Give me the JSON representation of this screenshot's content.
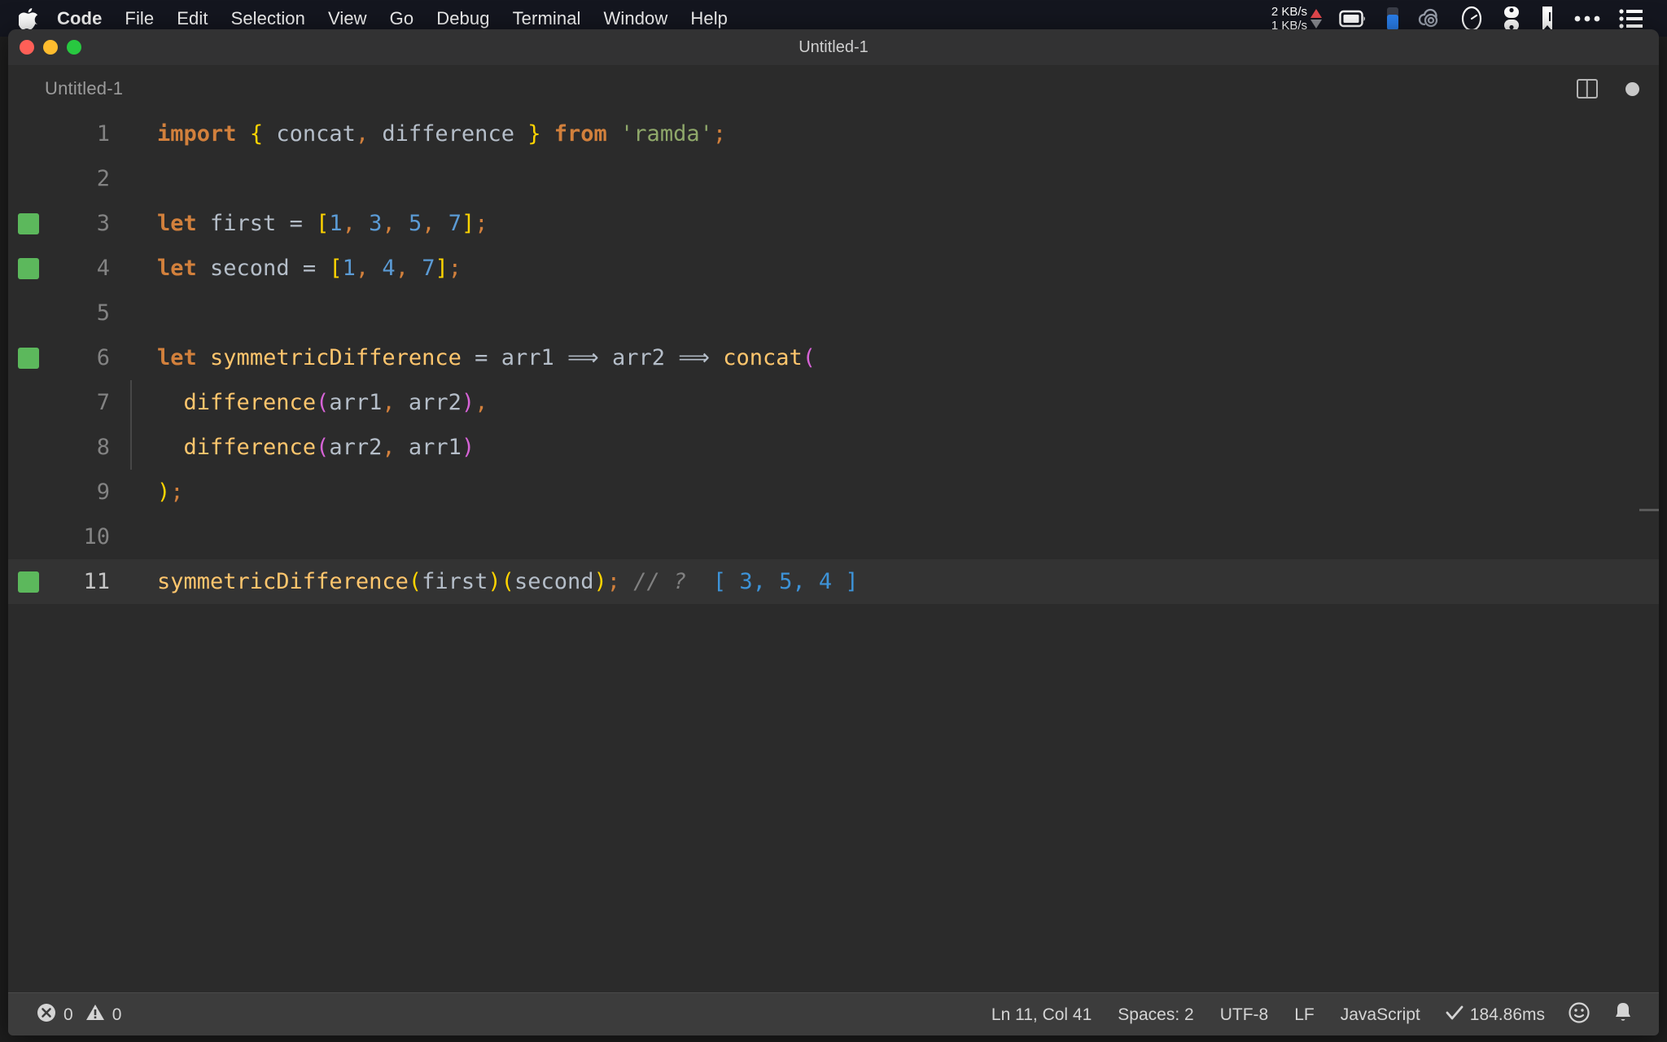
{
  "menubar": {
    "apple_icon": "apple-logo-icon",
    "items": [
      {
        "label": "Code",
        "bold": true
      },
      {
        "label": "File",
        "bold": false
      },
      {
        "label": "Edit",
        "bold": false
      },
      {
        "label": "Selection",
        "bold": false
      },
      {
        "label": "View",
        "bold": false
      },
      {
        "label": "Go",
        "bold": false
      },
      {
        "label": "Debug",
        "bold": false
      },
      {
        "label": "Terminal",
        "bold": false
      },
      {
        "label": "Window",
        "bold": false
      },
      {
        "label": "Help",
        "bold": false
      }
    ],
    "network": {
      "upload": "2 KB/s",
      "download": "1 KB/s",
      "up_arrow_color": "#e5484d",
      "down_arrow_color": "#8b8d93"
    },
    "status_icons": [
      "battery-icon",
      "battery-gauge-icon",
      "cloud-sync-icon",
      "timer-icon",
      "toggles-icon",
      "bookmark-icon",
      "ellipsis-icon",
      "list-menu-icon"
    ]
  },
  "window": {
    "title": "Untitled-1",
    "traffic_lights": [
      "close-button",
      "minimize-button",
      "maximize-button"
    ]
  },
  "tabstrip": {
    "tab_label": "Untitled-1",
    "split_editor_label": "split-editor-icon",
    "unsaved_indicator_label": "unsaved-dot-icon"
  },
  "editor": {
    "language": "JavaScript",
    "active_line": 11,
    "lines": [
      {
        "number": "1",
        "marked": false,
        "active": false,
        "tokens": [
          {
            "text": "import",
            "cls": "t-keyword"
          },
          {
            "text": " ",
            "cls": "t-plain"
          },
          {
            "text": "{",
            "cls": "t-brace"
          },
          {
            "text": " concat",
            "cls": "t-plain"
          },
          {
            "text": ",",
            "cls": "t-punct"
          },
          {
            "text": " difference ",
            "cls": "t-plain"
          },
          {
            "text": "}",
            "cls": "t-brace"
          },
          {
            "text": " ",
            "cls": "t-plain"
          },
          {
            "text": "from",
            "cls": "t-keyword"
          },
          {
            "text": " ",
            "cls": "t-plain"
          },
          {
            "text": "'ramda'",
            "cls": "t-string"
          },
          {
            "text": ";",
            "cls": "t-punct"
          }
        ]
      },
      {
        "number": "2",
        "marked": false,
        "active": false,
        "tokens": []
      },
      {
        "number": "3",
        "marked": true,
        "active": false,
        "tokens": [
          {
            "text": "let",
            "cls": "t-keyword"
          },
          {
            "text": " first ",
            "cls": "t-plain"
          },
          {
            "text": "=",
            "cls": "t-plain"
          },
          {
            "text": " ",
            "cls": "t-plain"
          },
          {
            "text": "[",
            "cls": "t-brace"
          },
          {
            "text": "1",
            "cls": "t-number"
          },
          {
            "text": ",",
            "cls": "t-punct"
          },
          {
            "text": " ",
            "cls": "t-plain"
          },
          {
            "text": "3",
            "cls": "t-number"
          },
          {
            "text": ",",
            "cls": "t-punct"
          },
          {
            "text": " ",
            "cls": "t-plain"
          },
          {
            "text": "5",
            "cls": "t-number"
          },
          {
            "text": ",",
            "cls": "t-punct"
          },
          {
            "text": " ",
            "cls": "t-plain"
          },
          {
            "text": "7",
            "cls": "t-number"
          },
          {
            "text": "]",
            "cls": "t-brace"
          },
          {
            "text": ";",
            "cls": "t-punct"
          }
        ]
      },
      {
        "number": "4",
        "marked": true,
        "active": false,
        "tokens": [
          {
            "text": "let",
            "cls": "t-keyword"
          },
          {
            "text": " second ",
            "cls": "t-plain"
          },
          {
            "text": "=",
            "cls": "t-plain"
          },
          {
            "text": " ",
            "cls": "t-plain"
          },
          {
            "text": "[",
            "cls": "t-brace"
          },
          {
            "text": "1",
            "cls": "t-number"
          },
          {
            "text": ",",
            "cls": "t-punct"
          },
          {
            "text": " ",
            "cls": "t-plain"
          },
          {
            "text": "4",
            "cls": "t-number"
          },
          {
            "text": ",",
            "cls": "t-punct"
          },
          {
            "text": " ",
            "cls": "t-plain"
          },
          {
            "text": "7",
            "cls": "t-number"
          },
          {
            "text": "]",
            "cls": "t-brace"
          },
          {
            "text": ";",
            "cls": "t-punct"
          }
        ]
      },
      {
        "number": "5",
        "marked": false,
        "active": false,
        "tokens": []
      },
      {
        "number": "6",
        "marked": true,
        "active": false,
        "tokens": [
          {
            "text": "let",
            "cls": "t-keyword"
          },
          {
            "text": " ",
            "cls": "t-plain"
          },
          {
            "text": "symmetricDifference",
            "cls": "t-var"
          },
          {
            "text": " ",
            "cls": "t-plain"
          },
          {
            "text": "=",
            "cls": "t-plain"
          },
          {
            "text": " arr1 ",
            "cls": "t-plain"
          },
          {
            "text": "⟹",
            "cls": "t-arrow"
          },
          {
            "text": " arr2 ",
            "cls": "t-plain"
          },
          {
            "text": "⟹",
            "cls": "t-arrow"
          },
          {
            "text": " ",
            "cls": "t-plain"
          },
          {
            "text": "concat",
            "cls": "t-func"
          },
          {
            "text": "(",
            "cls": "t-paren-m"
          }
        ]
      },
      {
        "number": "7",
        "marked": false,
        "active": false,
        "indent_guide": true,
        "tokens": [
          {
            "text": "  ",
            "cls": "t-plain"
          },
          {
            "text": "difference",
            "cls": "t-func"
          },
          {
            "text": "(",
            "cls": "t-paren-m"
          },
          {
            "text": "arr1",
            "cls": "t-plain"
          },
          {
            "text": ",",
            "cls": "t-punct"
          },
          {
            "text": " arr2",
            "cls": "t-plain"
          },
          {
            "text": ")",
            "cls": "t-paren-m"
          },
          {
            "text": ",",
            "cls": "t-punct"
          }
        ]
      },
      {
        "number": "8",
        "marked": false,
        "active": false,
        "indent_guide": true,
        "tokens": [
          {
            "text": "  ",
            "cls": "t-plain"
          },
          {
            "text": "difference",
            "cls": "t-func"
          },
          {
            "text": "(",
            "cls": "t-paren-m"
          },
          {
            "text": "arr2",
            "cls": "t-plain"
          },
          {
            "text": ",",
            "cls": "t-punct"
          },
          {
            "text": " arr1",
            "cls": "t-plain"
          },
          {
            "text": ")",
            "cls": "t-paren-m"
          }
        ]
      },
      {
        "number": "9",
        "marked": false,
        "active": false,
        "tokens": [
          {
            "text": ")",
            "cls": "t-brace"
          },
          {
            "text": ";",
            "cls": "t-punct"
          }
        ]
      },
      {
        "number": "10",
        "marked": false,
        "active": false,
        "tokens": []
      },
      {
        "number": "11",
        "marked": true,
        "active": true,
        "tokens": [
          {
            "text": "symmetricDifference",
            "cls": "t-func"
          },
          {
            "text": "(",
            "cls": "t-brace"
          },
          {
            "text": "first",
            "cls": "t-plain"
          },
          {
            "text": ")",
            "cls": "t-brace"
          },
          {
            "text": "(",
            "cls": "t-brace"
          },
          {
            "text": "second",
            "cls": "t-plain"
          },
          {
            "text": ")",
            "cls": "t-brace"
          },
          {
            "text": ";",
            "cls": "t-punct"
          },
          {
            "text": " ",
            "cls": "t-plain"
          },
          {
            "text": "// ?",
            "cls": "t-comment"
          },
          {
            "text": "  ",
            "cls": "t-plain"
          },
          {
            "text": "[ 3, 5, 4 ]",
            "cls": "t-result"
          }
        ]
      }
    ]
  },
  "statusbar": {
    "errors_icon": "error-circle-icon",
    "errors_count": "0",
    "warnings_icon": "warning-triangle-icon",
    "warnings_count": "0",
    "cursor_position": "Ln 11, Col 41",
    "indentation": "Spaces: 2",
    "encoding": "UTF-8",
    "line_ending": "LF",
    "language_mode": "JavaScript",
    "run_check_icon": "checkmark-icon",
    "run_time": "184.86ms",
    "feedback_icon": "smiley-icon",
    "notifications_icon": "bell-icon"
  },
  "colors": {
    "menubar_bg": "#14161f",
    "editor_bg": "#2b2b2b",
    "active_line_bg": "#333333",
    "statusbar_bg": "#3c3c3c",
    "titlebar_bg": "#323233",
    "gutter_mark": "#5cb85c",
    "keyword": "#d2803c",
    "string": "#8fa86a",
    "number": "#5b9bd5",
    "function": "#ffc66d",
    "brace": "#ffd400",
    "paren": "#d663d6",
    "comment": "#808080",
    "result": "#3d93d8"
  }
}
